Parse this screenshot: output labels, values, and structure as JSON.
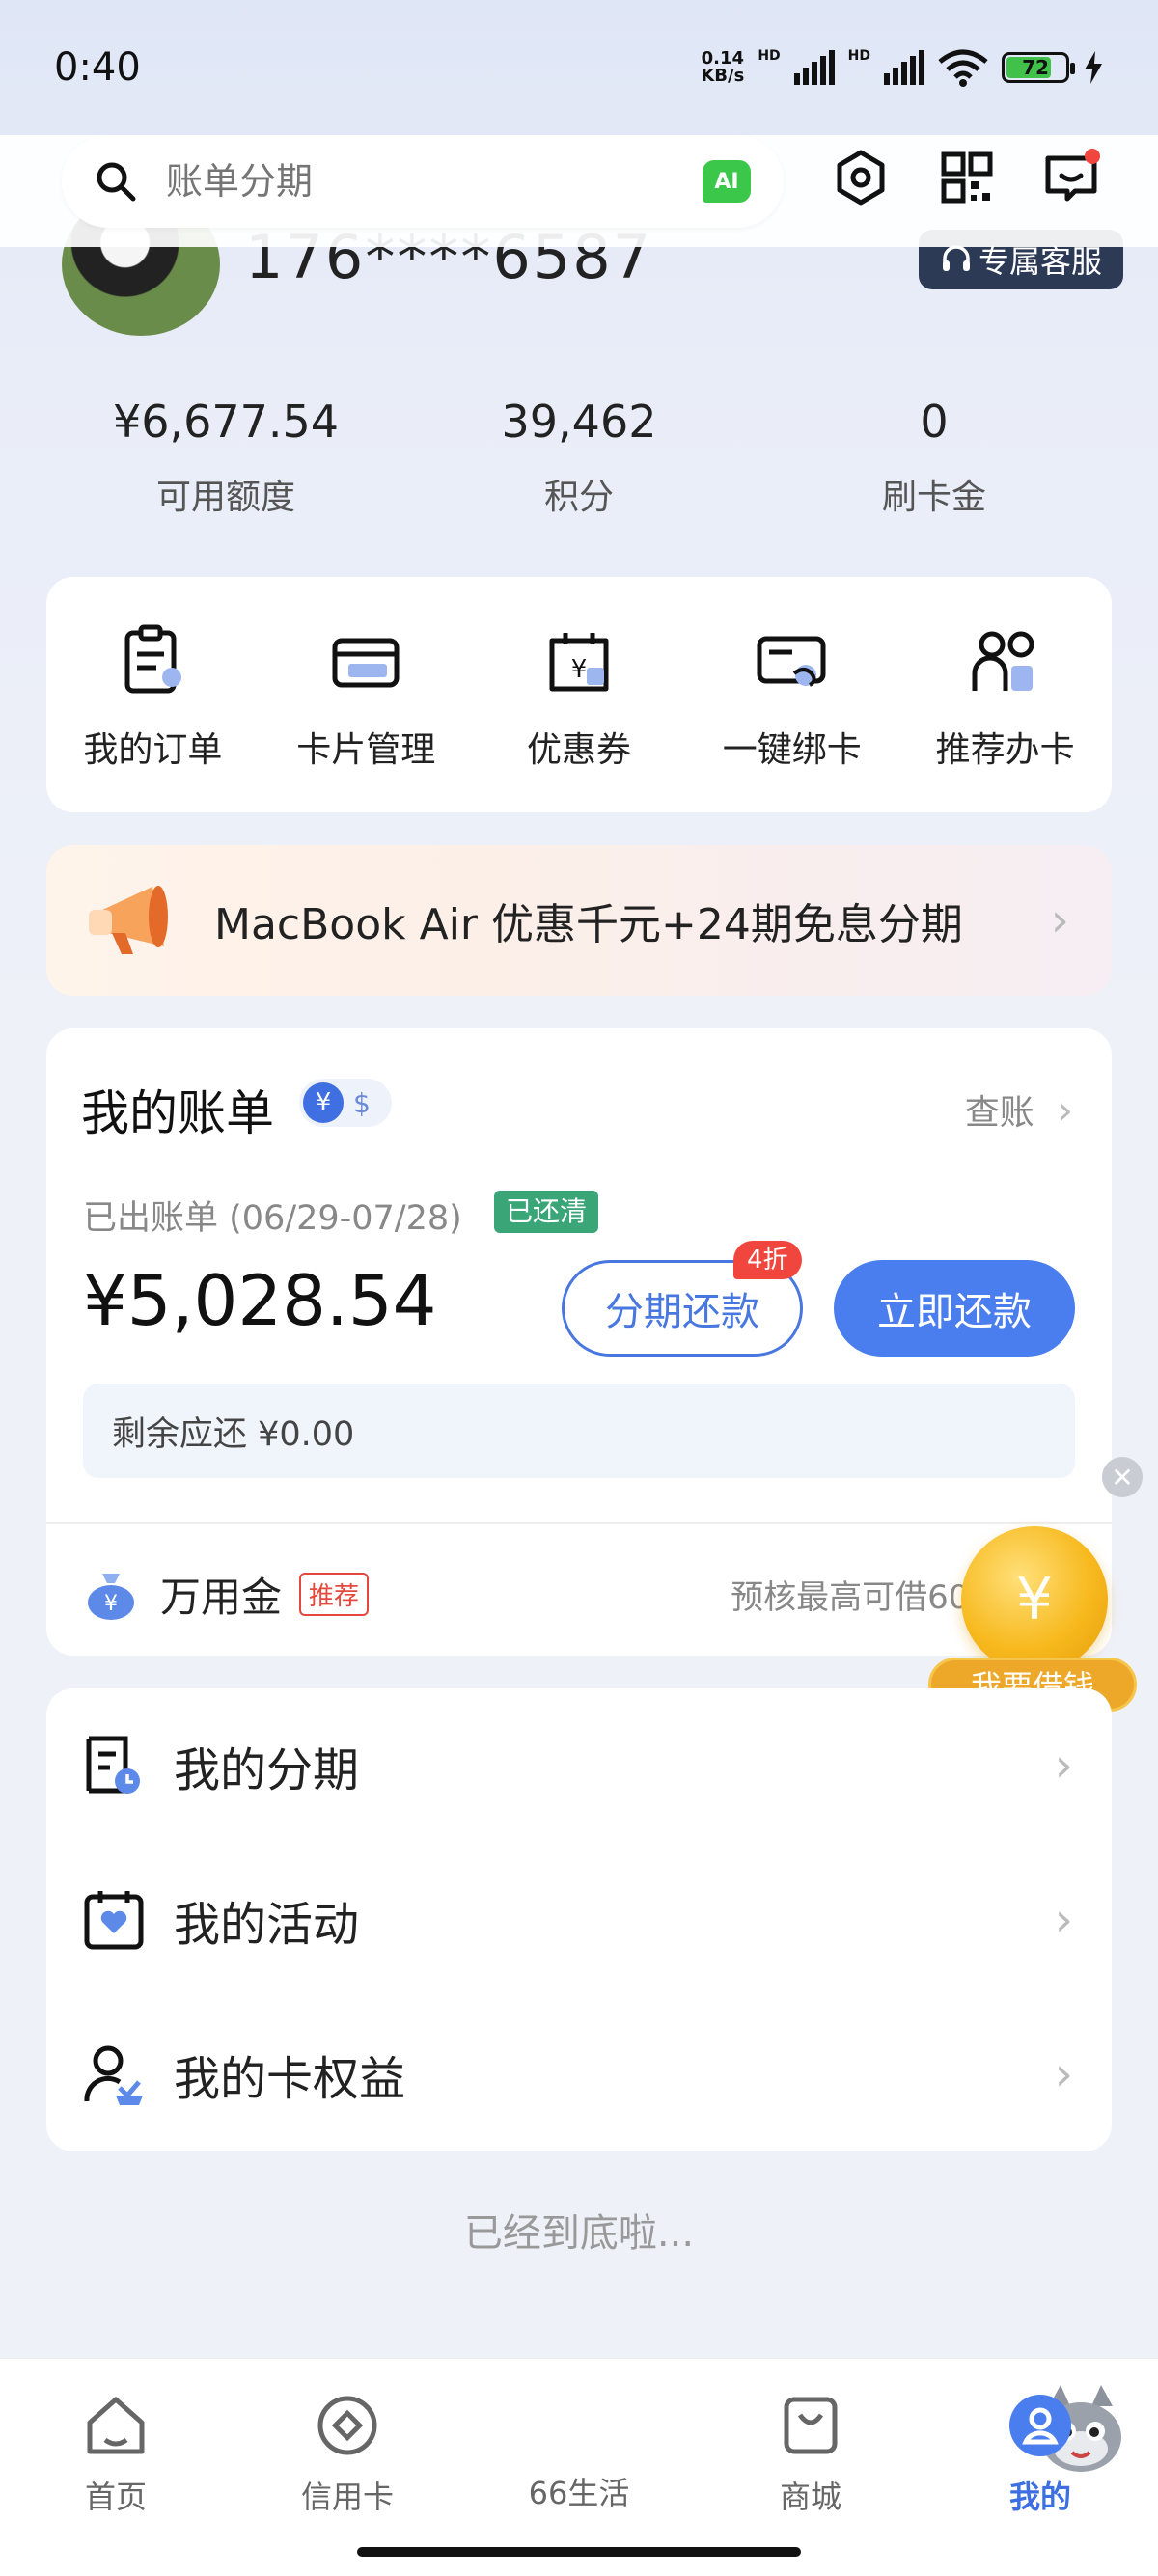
{
  "status_bar": {
    "time": "0:40",
    "net_speed_value": "0.14",
    "net_speed_unit": "KB/s",
    "hd1": "HD",
    "hd2": "HD",
    "battery": "72"
  },
  "search": {
    "placeholder": "账单分期",
    "ai_label": "AI"
  },
  "profile": {
    "phone": "176****6587",
    "service_label": "专属客服"
  },
  "stats": [
    {
      "value": "¥6,677.54",
      "label": "可用额度"
    },
    {
      "value": "39,462",
      "label": "积分"
    },
    {
      "value": "0",
      "label": "刷卡金"
    }
  ],
  "quick_menu": [
    {
      "label": "我的订单",
      "icon": "order-icon"
    },
    {
      "label": "卡片管理",
      "icon": "card-icon"
    },
    {
      "label": "优惠券",
      "icon": "coupon-icon"
    },
    {
      "label": "一键绑卡",
      "icon": "bind-card-icon"
    },
    {
      "label": "推荐办卡",
      "icon": "recommend-icon"
    }
  ],
  "promo": {
    "text": "MacBook Air 优惠千元+24期免息分期"
  },
  "bill": {
    "title": "我的账单",
    "yen": "¥",
    "usd": "$",
    "check_link": "查账",
    "period": "已出账单 (06/29-07/28)",
    "status": "已还清",
    "amount": "¥5,028.54",
    "install_btn": "分期还款",
    "discount": "4折",
    "pay_btn": "立即还款",
    "remaining": "剩余应还 ¥0.00",
    "wanyong_label": "万用金",
    "wanyong_tag": "推荐",
    "wanyong_hint": "预核最高可借600"
  },
  "borrow": {
    "coin": "¥",
    "label": "我要借钱",
    "close": "✕"
  },
  "menu": [
    {
      "label": "我的分期",
      "icon": "installment-icon"
    },
    {
      "label": "我的活动",
      "icon": "activity-icon"
    },
    {
      "label": "我的卡权益",
      "icon": "card-rights-icon"
    }
  ],
  "end_text": "已经到底啦...",
  "nav": [
    {
      "label": "首页"
    },
    {
      "label": "信用卡"
    },
    {
      "label": "66生活"
    },
    {
      "label": "商城"
    },
    {
      "label": "我的"
    }
  ],
  "colors": {
    "accent": "#4a7ded",
    "paid": "#3aa678",
    "discount": "#f0463e"
  }
}
